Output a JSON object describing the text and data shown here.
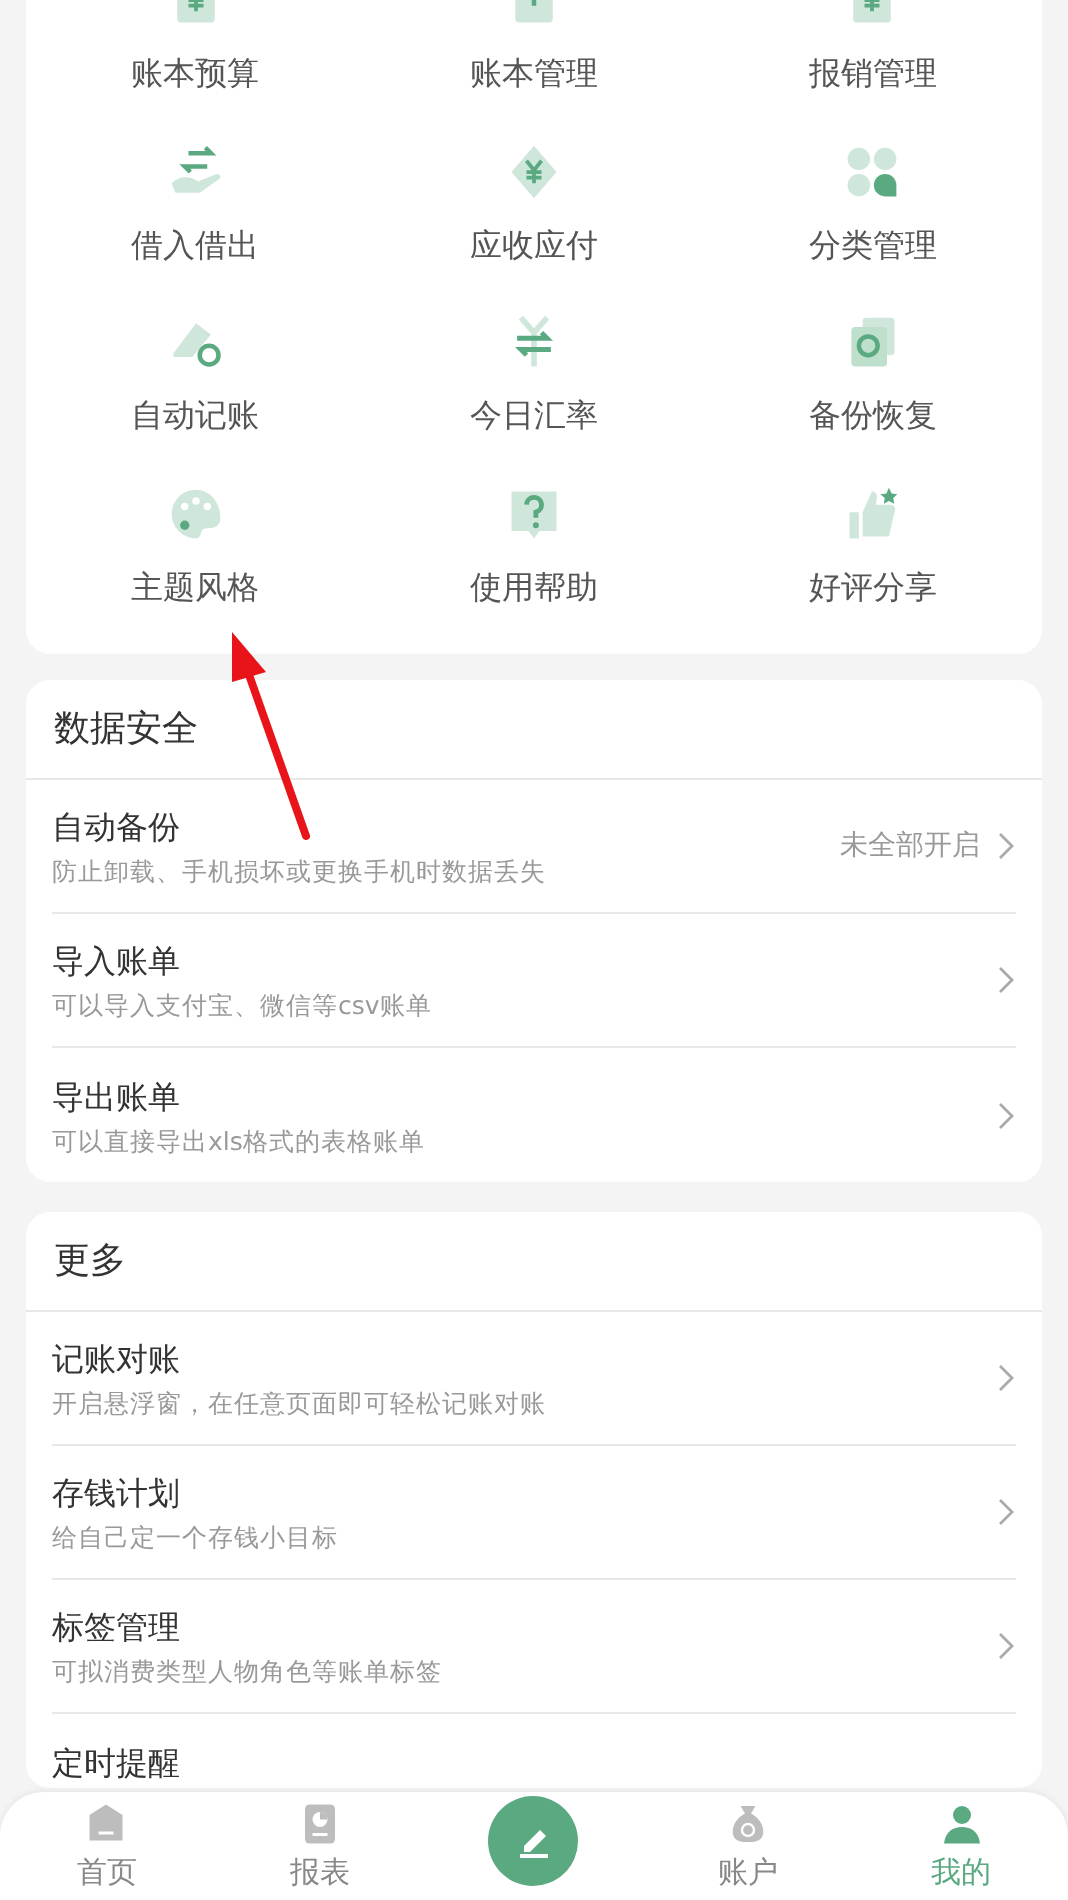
{
  "grid_items": [
    {
      "label": "账本预算"
    },
    {
      "label": "账本管理"
    },
    {
      "label": "报销管理"
    },
    {
      "label": "借入借出"
    },
    {
      "label": "应收应付"
    },
    {
      "label": "分类管理"
    },
    {
      "label": "自动记账"
    },
    {
      "label": "今日汇率"
    },
    {
      "label": "备份恢复"
    },
    {
      "label": "主题风格"
    },
    {
      "label": "使用帮助"
    },
    {
      "label": "好评分享"
    }
  ],
  "sections": [
    {
      "title": "数据安全",
      "rows": [
        {
          "title": "自动备份",
          "subtitle": "防止卸载、手机损坏或更换手机时数据丢失",
          "value": "未全部开启"
        },
        {
          "title": "导入账单",
          "subtitle": "可以导入支付宝、微信等csv账单"
        },
        {
          "title": "导出账单",
          "subtitle": "可以直接导出xls格式的表格账单"
        }
      ]
    },
    {
      "title": "更多",
      "rows": [
        {
          "title": "记账对账",
          "subtitle": "开启悬浮窗，在任意页面即可轻松记账对账"
        },
        {
          "title": "存钱计划",
          "subtitle": "给自己定一个存钱小目标"
        },
        {
          "title": "标签管理",
          "subtitle": "可拟消费类型人物角色等账单标签"
        },
        {
          "title": "定时提醒"
        }
      ]
    }
  ],
  "bottom_nav": [
    {
      "kind": "tab",
      "label": "首页",
      "selected": false
    },
    {
      "kind": "tab",
      "label": "报表",
      "selected": false
    },
    {
      "kind": "action"
    },
    {
      "kind": "tab",
      "label": "账户",
      "selected": false
    },
    {
      "kind": "tab",
      "label": "我的",
      "selected": true
    }
  ]
}
